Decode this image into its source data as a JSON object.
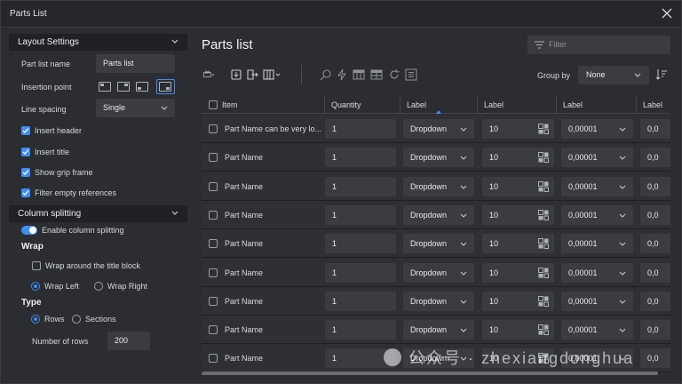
{
  "window": {
    "title": "Parts List"
  },
  "layout_settings": {
    "header": "Layout Settings",
    "part_list_name_label": "Part list name",
    "part_list_name_value": "Parts list",
    "insertion_point_label": "Insertion point",
    "insertion_point_selected": "bottom-right",
    "line_spacing_label": "Line spacing",
    "line_spacing_value": "Single",
    "checkboxes": [
      {
        "label": "Insert header",
        "checked": true
      },
      {
        "label": "Insert title",
        "checked": true
      },
      {
        "label": "Show grip frame",
        "checked": true
      },
      {
        "label": "Filter empty references",
        "checked": true
      }
    ]
  },
  "column_splitting": {
    "header": "Column splitting",
    "enable_label": "Enable column splitting",
    "enabled": true,
    "wrap_heading": "Wrap",
    "wrap_around_label": "Wrap around the title block",
    "wrap_around_checked": false,
    "wrap_left_label": "Wrap Left",
    "wrap_right_label": "Wrap Right",
    "wrap_selected": "Wrap Left",
    "type_heading": "Type",
    "rows_label": "Rows",
    "sections_label": "Sections",
    "type_selected": "Rows",
    "number_of_rows_label": "Number of rows",
    "number_of_rows_value": "200"
  },
  "main": {
    "title": "Parts list",
    "filter_placeholder": "Filter",
    "group_by_label": "Group by",
    "group_by_value": "None"
  },
  "grid": {
    "columns": [
      "Item",
      "Quantity",
      "Label",
      "Label",
      "Label",
      "Label"
    ],
    "rows": [
      {
        "name": "Part Name can be very lo...",
        "qty": "1",
        "dropdown": "Dropdown",
        "num": "10",
        "dec": "0,00001",
        "last": "0,0"
      },
      {
        "name": "Part Name",
        "qty": "1",
        "dropdown": "Dropdown",
        "num": "10",
        "dec": "0,00001",
        "last": "0,0"
      },
      {
        "name": "Part Name",
        "qty": "1",
        "dropdown": "Dropdown",
        "num": "10",
        "dec": "0,00001",
        "last": "0,0"
      },
      {
        "name": "Part Name",
        "qty": "1",
        "dropdown": "Dropdown",
        "num": "10",
        "dec": "0,00001",
        "last": "0,0"
      },
      {
        "name": "Part Name",
        "qty": "1",
        "dropdown": "Dropdown",
        "num": "10",
        "dec": "0,00001",
        "last": "0,0"
      },
      {
        "name": "Part Name",
        "qty": "1",
        "dropdown": "Dropdown",
        "num": "10",
        "dec": "0,00001",
        "last": "0,0"
      },
      {
        "name": "Part Name",
        "qty": "1",
        "dropdown": "Dropdown",
        "num": "10",
        "dec": "0,00001",
        "last": "0,0"
      },
      {
        "name": "Part Name",
        "qty": "1",
        "dropdown": "Dropdown",
        "num": "10",
        "dec": "0,00001",
        "last": "0,0"
      },
      {
        "name": "Part Name",
        "qty": "1",
        "dropdown": "Dropdown",
        "num": "10",
        "dec": "0,00001",
        "last": "0,0"
      }
    ]
  },
  "watermark": {
    "text": "公众号 · zhexiangdonghua"
  },
  "colors": {
    "accent": "#3e8ef7",
    "background": "#2b2d31",
    "field": "#3a3c41"
  }
}
